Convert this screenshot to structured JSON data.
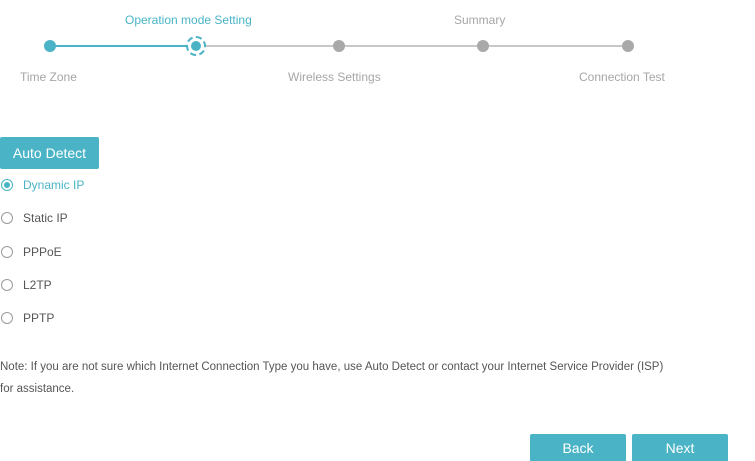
{
  "stepper": {
    "steps": [
      {
        "label": "Time Zone",
        "state": "done"
      },
      {
        "label": "Operation mode Setting",
        "state": "current"
      },
      {
        "label": "Wireless Settings",
        "state": "todo"
      },
      {
        "label": "Summary",
        "state": "todo"
      },
      {
        "label": "Connection Test",
        "state": "todo"
      }
    ]
  },
  "auto_detect_label": "Auto Detect",
  "connection_types": [
    {
      "label": "Dynamic IP",
      "selected": true
    },
    {
      "label": "Static IP",
      "selected": false
    },
    {
      "label": "PPPoE",
      "selected": false
    },
    {
      "label": "L2TP",
      "selected": false
    },
    {
      "label": "PPTP",
      "selected": false
    }
  ],
  "note": {
    "line1": "Note: If you are not sure which Internet Connection Type you have, use Auto Detect or contact your Internet Service Provider (ISP)",
    "line2": "for assistance."
  },
  "footer": {
    "back_label": "Back",
    "next_label": "Next"
  },
  "colors": {
    "accent": "#4ab4c6",
    "inactive_node": "#a9a9a9",
    "inactive_track": "#c8c8c8"
  }
}
